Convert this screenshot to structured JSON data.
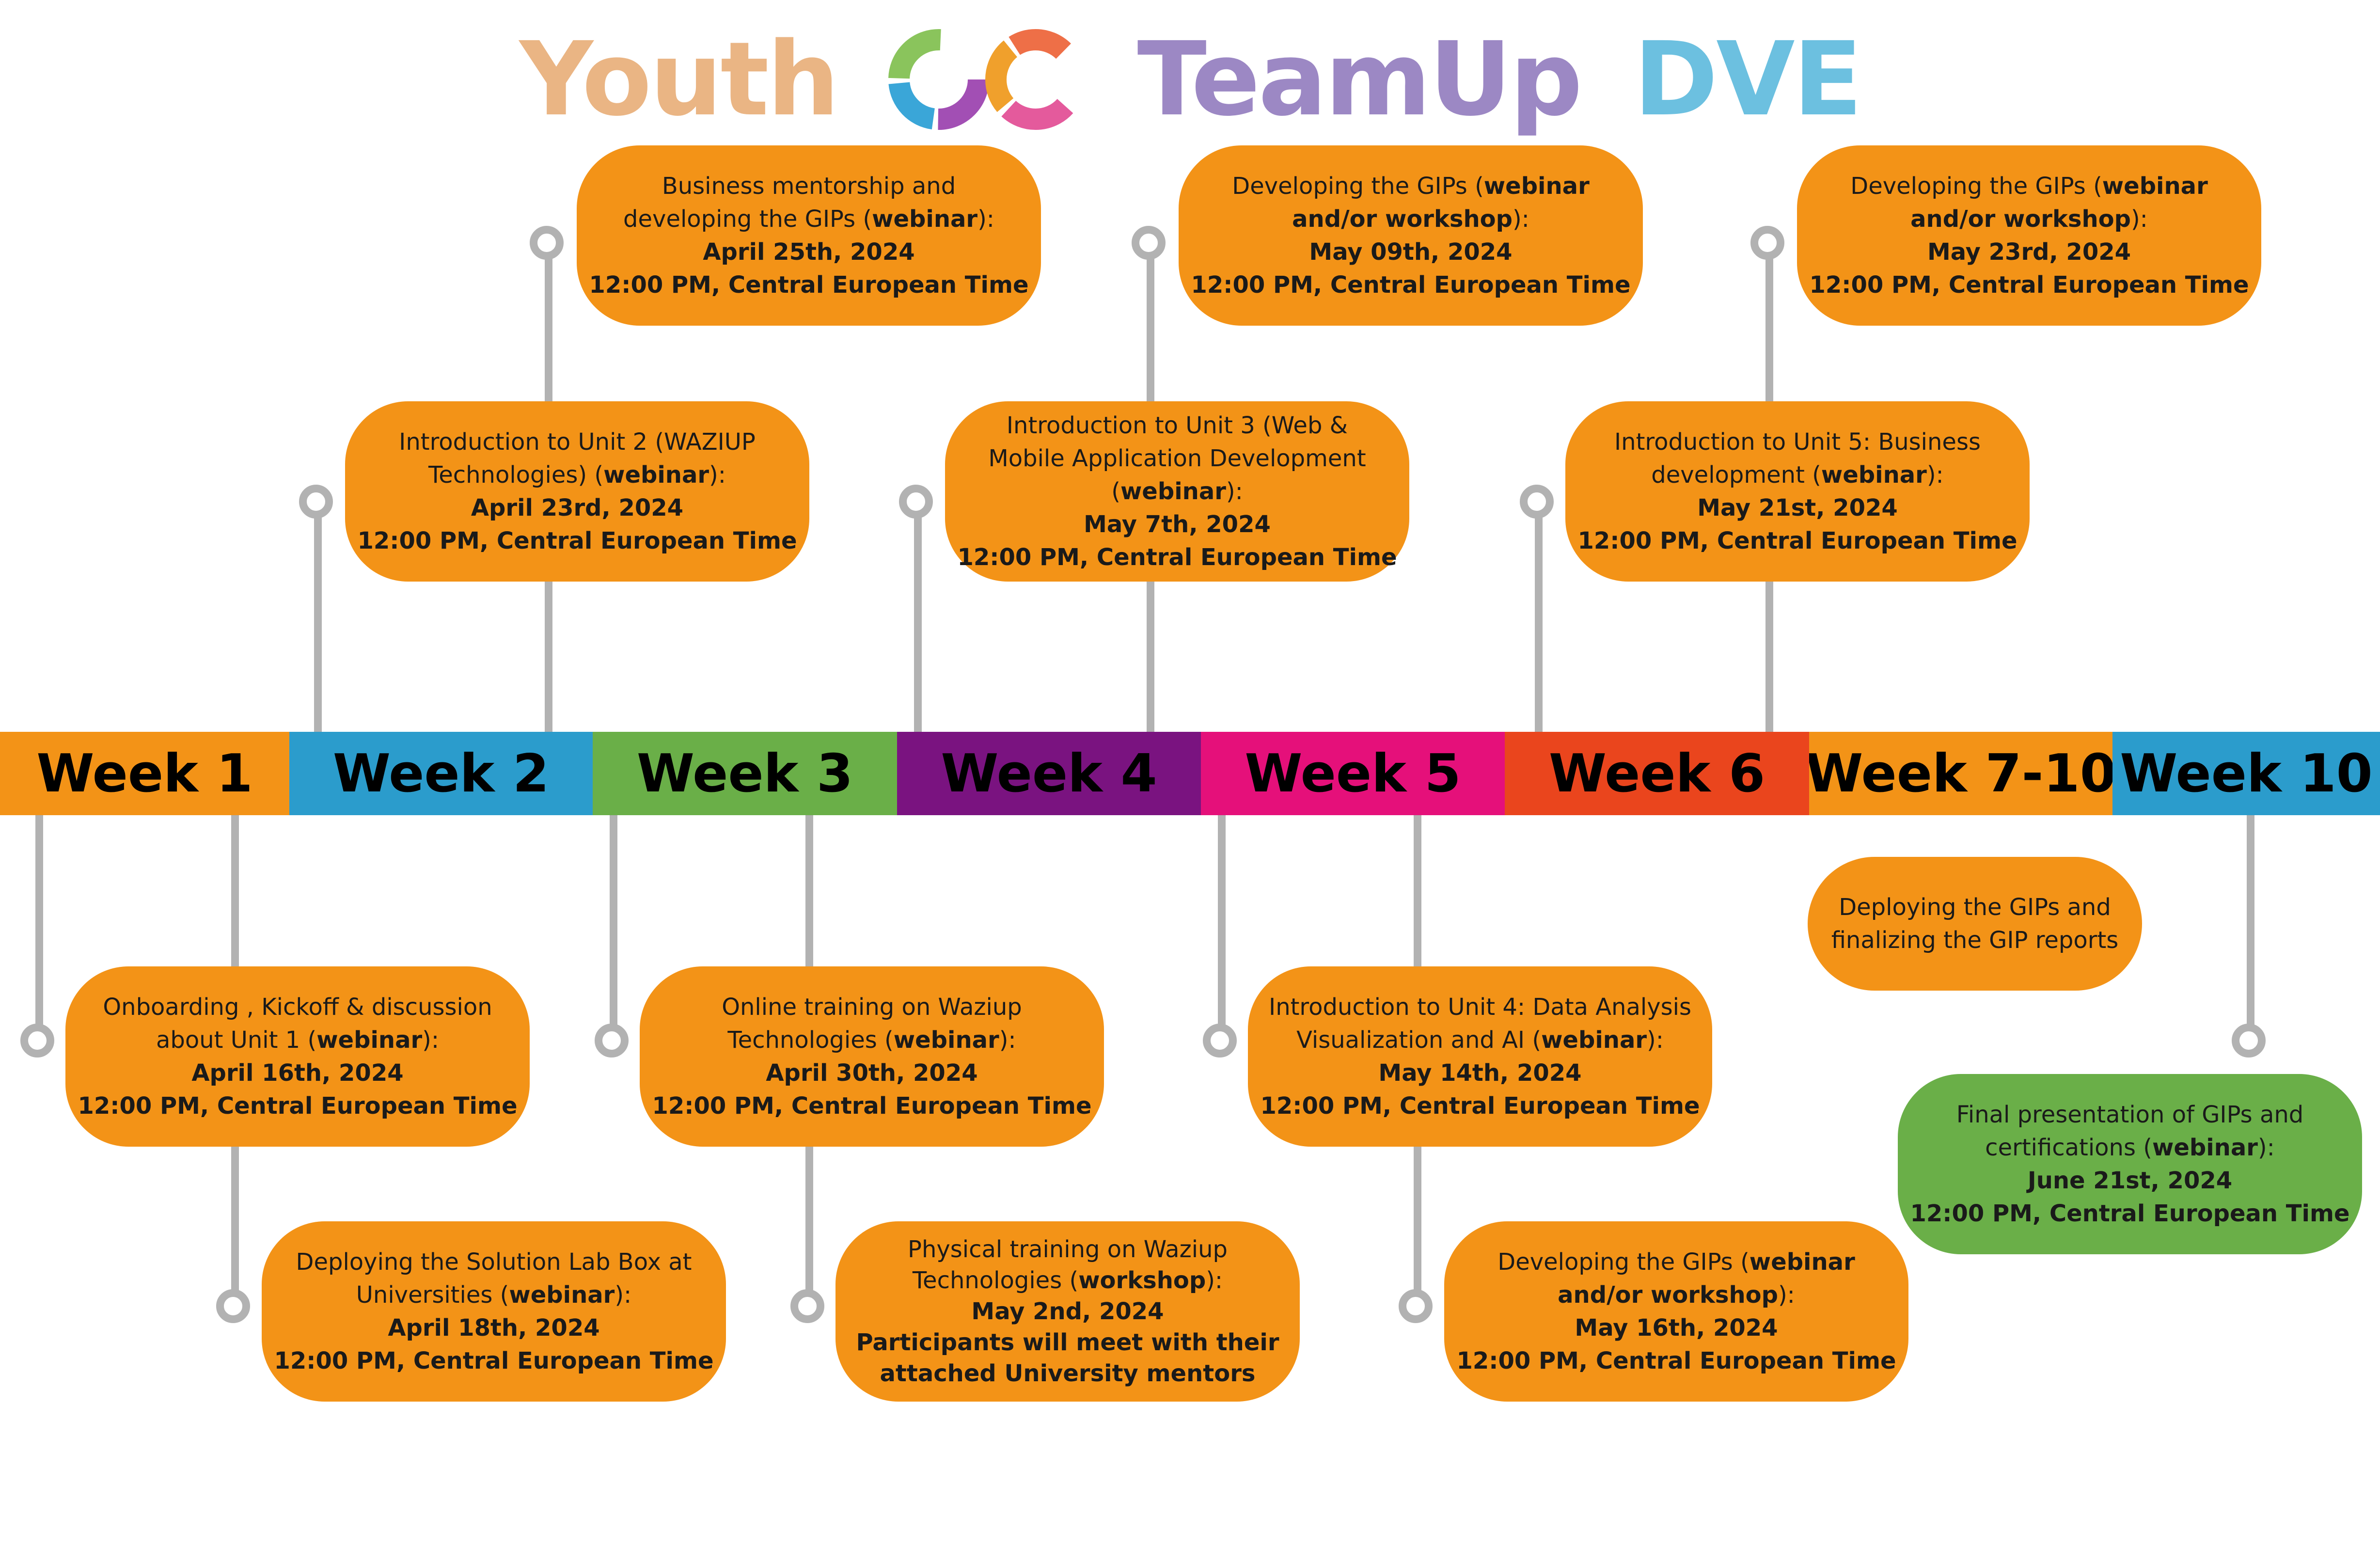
{
  "title": {
    "word1": "Youth",
    "word2": "TeamUp",
    "word3": "DVE"
  },
  "colors": {
    "orange": "#f39317",
    "green": "#6aaf48",
    "blue": "#2b9ccc",
    "purple": "#7a1380",
    "pink": "#e5107a",
    "red": "#ea451d",
    "stem": "#b2b2b2",
    "title_youth": "#eab584",
    "title_teamup": "#9c88c4",
    "title_dve": "#6cc0e0"
  },
  "weeks": [
    {
      "label": "Week 1",
      "color": "#f39317"
    },
    {
      "label": "Week 2",
      "color": "#2b9ccc"
    },
    {
      "label": "Week 3",
      "color": "#6aaf48"
    },
    {
      "label": "Week 4",
      "color": "#7a1380"
    },
    {
      "label": "Week 5",
      "color": "#e5107a"
    },
    {
      "label": "Week 6",
      "color": "#ea451d"
    },
    {
      "label": "Week 7-10",
      "color": "#f39317"
    },
    {
      "label": "Week 10",
      "color": "#2b9ccc"
    }
  ],
  "events": {
    "w1_onboarding": {
      "text1": "Onboarding , Kickoff & discussion",
      "text2a": "about Unit 1 (",
      "text2b": "webinar",
      "text2c": "):",
      "date": "April 16th, 2024",
      "time": "12:00 PM, Central European Time"
    },
    "w1_solution_lab": {
      "text1": "Deploying the Solution Lab Box at",
      "text2a": "Universities  (",
      "text2b": "webinar",
      "text2c": "):",
      "date": "April 18th, 2024",
      "time": "12:00 PM, Central European Time"
    },
    "w2_unit2": {
      "text1": "Introduction to Unit 2 (WAZIUP",
      "text2a": "Technologies) (",
      "text2b": "webinar",
      "text2c": "):",
      "date": "April 23rd, 2024",
      "time": "12:00 PM, Central European Time"
    },
    "w2_mentorship": {
      "text1": "Business mentorship and",
      "text2a": "developing the GIPs (",
      "text2b": "webinar",
      "text2c": "):",
      "date": "April 25th, 2024",
      "time": "12:00 PM, Central European Time"
    },
    "w3_online": {
      "text1": "Online training on Waziup",
      "text2a": "Technologies (",
      "text2b": "webinar",
      "text2c": "):",
      "date": "April 30th, 2024",
      "time": "12:00 PM, Central European Time"
    },
    "w3_physical": {
      "text1": "Physical training on Waziup",
      "text2a": "Technologies (",
      "text2b": "workshop",
      "text2c": "):",
      "date": "May 2nd, 2024",
      "note1": "Participants will meet with their",
      "note2": "attached University mentors"
    },
    "w4_unit3": {
      "text1": "Introduction to Unit 3 (Web &",
      "text2": "Mobile Application Development",
      "text3a": "(",
      "text3b": "webinar",
      "text3c": "):",
      "date": "May 7th, 2024",
      "time": "12:00 PM, Central European Time"
    },
    "w4_gips": {
      "text1a": "Developing the GIPs (",
      "text1b": "webinar",
      "text2a": "and/or workshop",
      "text2b": "):",
      "date": "May 09th, 2024",
      "time": "12:00 PM, Central European Time"
    },
    "w5_unit4": {
      "text1": "Introduction to Unit 4: Data Analysis",
      "text2a": "Visualization and AI (",
      "text2b": "webinar",
      "text2c": "):",
      "date": "May 14th, 2024",
      "time": "12:00 PM, Central European Time"
    },
    "w5_gips": {
      "text1a": "Developing the GIPs (",
      "text1b": "webinar",
      "text2a": "and/or workshop",
      "text2b": "):",
      "date": "May 16th, 2024",
      "time": "12:00 PM, Central European Time"
    },
    "w6_unit5": {
      "text1": "Introduction to Unit 5: Business",
      "text2a": "development (",
      "text2b": "webinar",
      "text2c": "):",
      "date": "May 21st, 2024",
      "time": "12:00 PM, Central European Time"
    },
    "w6_gips": {
      "text1a": "Developing the GIPs (",
      "text1b": "webinar",
      "text2a": "and/or workshop",
      "text2b": "):",
      "date": "May 23rd, 2024",
      "time": "12:00 PM, Central European Time"
    },
    "w7_deploying": {
      "text1": "Deploying the GIPs and",
      "text2": "finalizing the GIP reports"
    },
    "w10_final": {
      "text1": "Final presentation of GIPs and",
      "text2a": "certifications (",
      "text2b": "webinar",
      "text2c": "):",
      "date": "June 21st, 2024",
      "time": "12:00 PM, Central European Time"
    }
  }
}
